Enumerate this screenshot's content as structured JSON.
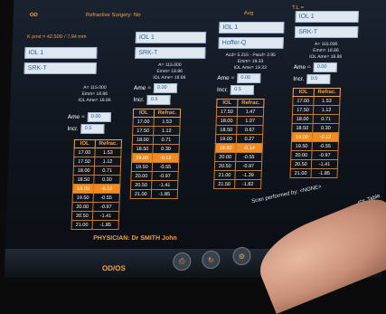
{
  "header": {
    "eye": "OD",
    "title": "Refractive Surgery: No",
    "k_post": "K post = 42.50D / 7.94 mm",
    "avg": "Avg",
    "tl": "T.L ="
  },
  "columns": [
    {
      "formula": "IOL 1",
      "lens": "SRK-T",
      "a": "A= 115.000",
      "emmetropia": "Emm= 18.86",
      "iol_ame_label": "IOL Ame= 18.86",
      "ame": "0.00",
      "incr": "0.5",
      "rows": [
        [
          "17.00",
          "1.53"
        ],
        [
          "17.50",
          "1.12"
        ],
        [
          "18.00",
          "0.71"
        ],
        [
          "18.50",
          "0.30"
        ],
        [
          "19.00",
          "-0.12"
        ],
        [
          "19.50",
          "-0.55"
        ],
        [
          "20.00",
          "-0.97"
        ],
        [
          "20.50",
          "-1.41"
        ],
        [
          "21.00",
          "-1.85"
        ]
      ],
      "hl": 4
    },
    {
      "formula": "IOL 1",
      "lens": "SRK-T",
      "a": "A= 115.000",
      "emmetropia": "Emm= 18.86",
      "iol_ame_label": "IOL Ame= 18.86",
      "ame": "0.00",
      "incr": "0.5",
      "rows": [
        [
          "17.00",
          "1.53"
        ],
        [
          "17.50",
          "1.12"
        ],
        [
          "18.00",
          "0.71"
        ],
        [
          "18.50",
          "0.30"
        ],
        [
          "19.00",
          "-0.12"
        ],
        [
          "19.50",
          "-0.55"
        ],
        [
          "20.00",
          "-0.97"
        ],
        [
          "20.50",
          "-1.41"
        ],
        [
          "21.00",
          "-1.85"
        ]
      ],
      "hl": 4
    },
    {
      "formula": "IOL 1",
      "lens": "Hoffer-Q",
      "a": "Acd= 5.215 - Pacd= 2.95",
      "emmetropia": "Emm= 19.33",
      "iol_ame_label": "IOL Ame= 19.33",
      "ame": "0.00",
      "incr": "0.5",
      "rows": [
        [
          "17.50",
          "1.47"
        ],
        [
          "18.00",
          "1.07"
        ],
        [
          "18.50",
          "0.67"
        ],
        [
          "19.00",
          "0.27"
        ],
        [
          "19.50",
          "-0.14"
        ],
        [
          "20.00",
          "-0.55"
        ],
        [
          "20.50",
          "-0.97"
        ],
        [
          "21.00",
          "-1.39"
        ],
        [
          "21.50",
          "-1.82"
        ]
      ],
      "hl": 4
    },
    {
      "formula": "IOL 1",
      "lens": "SRK-T",
      "a": "A= 115.000",
      "emmetropia": "Emm= 18.86",
      "iol_ame_label": "IOL Ame= 18.86",
      "ame": "0.00",
      "incr": "0.5",
      "rows": [
        [
          "17.00",
          "1.53"
        ],
        [
          "17.50",
          "1.12"
        ],
        [
          "18.00",
          "0.71"
        ],
        [
          "18.50",
          "0.30"
        ],
        [
          "19.00",
          "-0.12"
        ],
        [
          "19.50",
          "-0.55"
        ],
        [
          "20.00",
          "-0.97"
        ],
        [
          "20.50",
          "-1.41"
        ],
        [
          "21.00",
          "-1.85"
        ]
      ],
      "hl": 4
    }
  ],
  "table_headers": {
    "iol": "IOL",
    "refrac": "Refrac."
  },
  "labels": {
    "ame": "Ame =",
    "incr": "Incr."
  },
  "footer": {
    "scan": "Scan performed by: <NONE>",
    "iol_table": "IOL Table",
    "physician": "PHYSICIAN:  Dr SMITH John",
    "odos": "OD/OS"
  },
  "colors": {
    "accent": "#f2a24a",
    "highlight": "#f08c20",
    "field_bg": "#dfe7f1"
  }
}
